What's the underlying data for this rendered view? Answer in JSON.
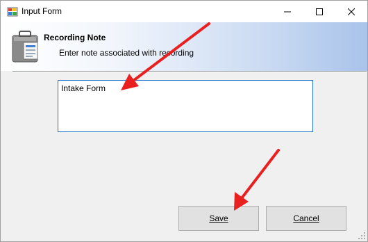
{
  "window": {
    "title": "Input Form"
  },
  "header": {
    "title": "Recording Note",
    "subtitle": "Enter note associated with recording"
  },
  "form": {
    "note_value": "Intake Form"
  },
  "buttons": {
    "save_label": "Save",
    "cancel_label": "Cancel"
  },
  "colors": {
    "annotation_arrow": "#e8201f",
    "input_focus_border": "#1e6fc9",
    "header_gradient_end": "#a9c3ea"
  },
  "icons": {
    "app": "form-app-icon",
    "header": "briefcase-document-icon"
  }
}
